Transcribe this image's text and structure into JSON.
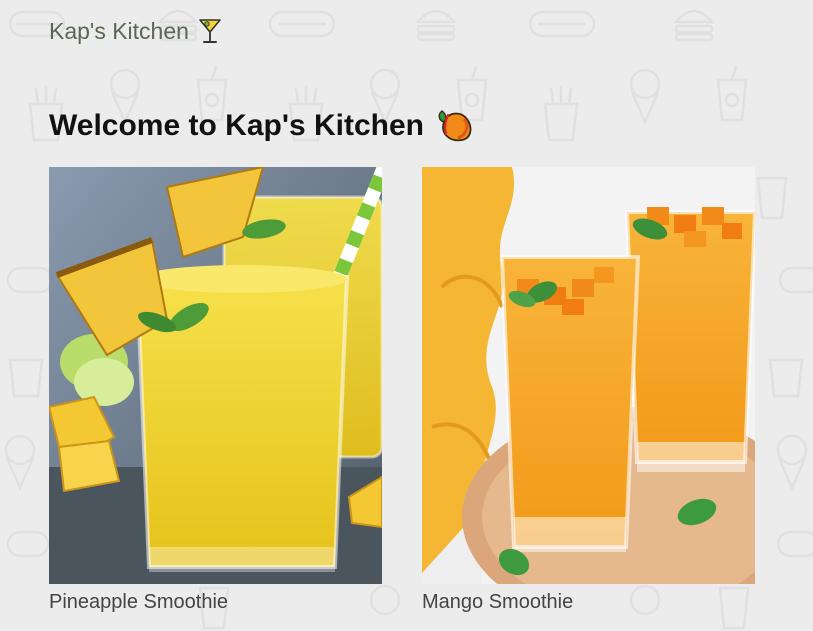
{
  "brand": {
    "name": "Kap's Kitchen",
    "icon": "cocktail-glass-icon"
  },
  "hero": {
    "title": "Welcome to Kap's Kitchen",
    "icon": "mango-icon"
  },
  "products": [
    {
      "name": "Pineapple Smoothie",
      "image": "pineapple-smoothie-photo",
      "accent": "#f2c61a"
    },
    {
      "name": "Mango Smoothie",
      "image": "mango-smoothie-photo",
      "accent": "#f5a21c"
    }
  ],
  "colors": {
    "background": "#ececec",
    "brand_text": "#5a6752",
    "title_text": "#111111"
  }
}
